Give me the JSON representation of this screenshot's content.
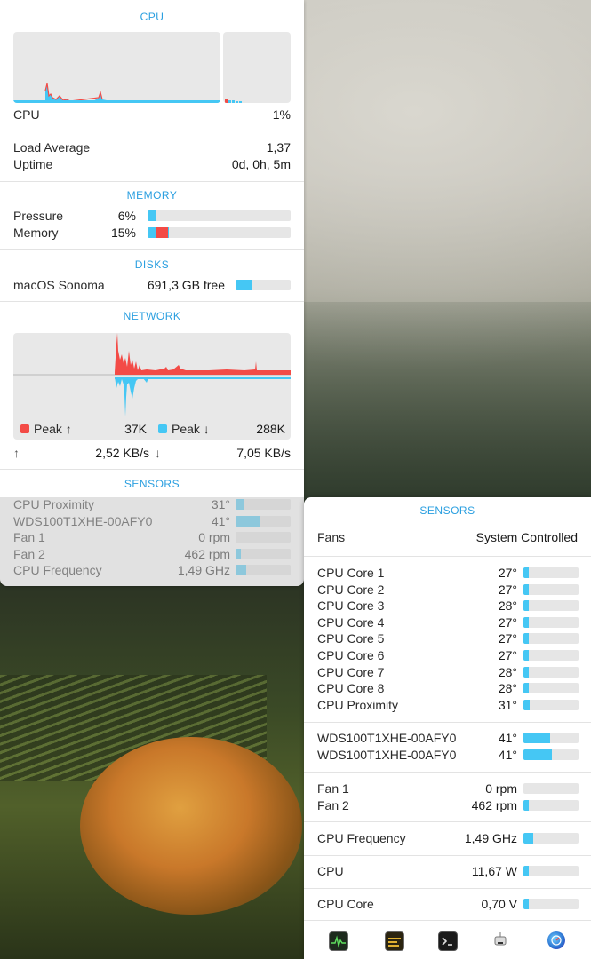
{
  "cpu": {
    "header": "CPU",
    "label": "CPU",
    "value": "1%",
    "load_label": "Load Average",
    "load_value": "1,37",
    "uptime_label": "Uptime",
    "uptime_value": "0d, 0h, 5m"
  },
  "memory": {
    "header": "MEMORY",
    "rows": [
      {
        "label": "Pressure",
        "value": "6%",
        "fraction": 0.06,
        "red_fraction": 0
      },
      {
        "label": "Memory",
        "value": "15%",
        "fraction": 0.15,
        "red_fraction": 0.08
      }
    ]
  },
  "disks": {
    "header": "DISKS",
    "label": "macOS Sonoma",
    "value": "691,3 GB free",
    "fraction": 0.31
  },
  "network": {
    "header": "NETWORK",
    "peak_up_label": "Peak ↑",
    "peak_up_value": "37K",
    "peak_down_label": "Peak ↓",
    "peak_down_value": "288K",
    "up_arrow": "↑",
    "up_value": "2,52 KB/s",
    "down_arrow": "↓",
    "down_value": "7,05 KB/s"
  },
  "sensors_main": {
    "header": "SENSORS",
    "rows": [
      {
        "label": "CPU Proximity",
        "value": "31°",
        "fraction": 0.15
      },
      {
        "label": "WDS100T1XHE-00AFY0",
        "value": "41°",
        "fraction": 0.45
      },
      {
        "label": "Fan 1",
        "value": "0 rpm",
        "fraction": 0
      },
      {
        "label": "Fan 2",
        "value": "462 rpm",
        "fraction": 0.1
      },
      {
        "label": "CPU Frequency",
        "value": "1,49 GHz",
        "fraction": 0.2
      }
    ]
  },
  "sensors_panel": {
    "header": "SENSORS",
    "fans_label": "Fans",
    "fans_value": "System Controlled",
    "cores": [
      {
        "label": "CPU Core 1",
        "value": "27°",
        "fraction": 0.1
      },
      {
        "label": "CPU Core 2",
        "value": "27°",
        "fraction": 0.1
      },
      {
        "label": "CPU Core 3",
        "value": "28°",
        "fraction": 0.1
      },
      {
        "label": "CPU Core 4",
        "value": "27°",
        "fraction": 0.1
      },
      {
        "label": "CPU Core 5",
        "value": "27°",
        "fraction": 0.1
      },
      {
        "label": "CPU Core 6",
        "value": "27°",
        "fraction": 0.1
      },
      {
        "label": "CPU Core 7",
        "value": "28°",
        "fraction": 0.1
      },
      {
        "label": "CPU Core 8",
        "value": "28°",
        "fraction": 0.1
      },
      {
        "label": "CPU Proximity",
        "value": "31°",
        "fraction": 0.12
      }
    ],
    "disks": [
      {
        "label": "WDS100T1XHE-00AFY0",
        "value": "41°",
        "fraction": 0.48
      },
      {
        "label": "WDS100T1XHE-00AFY0",
        "value": "41°",
        "fraction": 0.52
      }
    ],
    "fans": [
      {
        "label": "Fan 1",
        "value": "0 rpm",
        "fraction": 0
      },
      {
        "label": "Fan 2",
        "value": "462 rpm",
        "fraction": 0.08
      }
    ],
    "frequency": {
      "label": "CPU Frequency",
      "value": "1,49 GHz",
      "fraction": 0.18
    },
    "power": {
      "label": "CPU",
      "value": "11,67 W",
      "fraction": 0.02
    },
    "voltage": {
      "label": "CPU Core",
      "value": "0,70 V",
      "fraction": 0.08
    }
  },
  "colors": {
    "accent": "#2a9fe0",
    "bar_fill": "#45c7f4",
    "bar_red": "#f34b46",
    "bar_track": "#e6e6e6"
  },
  "dock_icons": [
    "activity-monitor-icon",
    "console-icon",
    "terminal-icon",
    "system-info-icon",
    "network-utility-icon"
  ]
}
